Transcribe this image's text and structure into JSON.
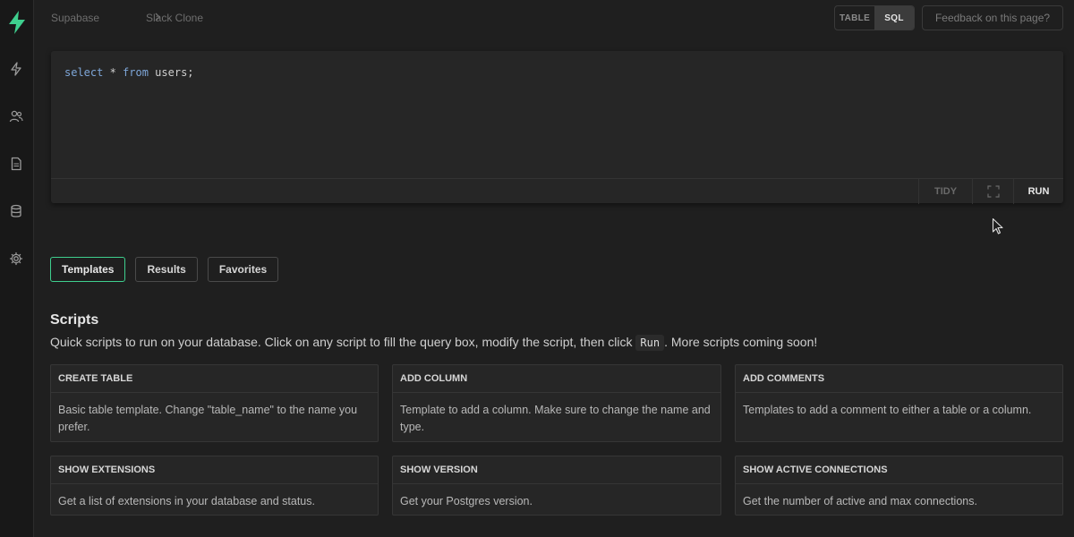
{
  "colors": {
    "accent": "#3ecf8e",
    "background": "#1f1f1f",
    "sidebar": "#181818",
    "keyword": "#7ea6d8"
  },
  "sidebar": {
    "logo": "supabase-bolt-logo",
    "items": [
      {
        "name": "lightning-icon"
      },
      {
        "name": "users-icon"
      },
      {
        "name": "document-icon"
      },
      {
        "name": "database-icon"
      },
      {
        "name": "gear-icon"
      }
    ]
  },
  "breadcrumb": {
    "root": "Supabase",
    "project": "Slack Clone"
  },
  "mode_toggle": {
    "table": "TABLE",
    "sql": "SQL",
    "active": "SQL"
  },
  "feedback": {
    "label": "Feedback on this page?"
  },
  "editor": {
    "code": {
      "kw1": "select",
      "star": " * ",
      "kw2": "from",
      "rest": " users;"
    },
    "tidy": "TIDY",
    "run": "RUN"
  },
  "tabs": [
    {
      "label": "Templates",
      "active": true
    },
    {
      "label": "Results"
    },
    {
      "label": "Favorites"
    }
  ],
  "scripts": {
    "title": "Scripts",
    "desc_before": "Quick scripts to run on your database. Click on any script to fill the query box, modify the script, then click ",
    "desc_kbd": "Run",
    "desc_after": ". More scripts coming soon!",
    "cards": [
      {
        "title": "CREATE TABLE",
        "body": "Basic table template. Change \"table_name\" to the name you prefer."
      },
      {
        "title": "ADD COLUMN",
        "body": "Template to add a column. Make sure to change the name and type."
      },
      {
        "title": "ADD COMMENTS",
        "body": "Templates to add a comment to either a table or a column."
      },
      {
        "title": "SHOW EXTENSIONS",
        "body": "Get a list of extensions in your database and status."
      },
      {
        "title": "SHOW VERSION",
        "body": "Get your Postgres version."
      },
      {
        "title": "SHOW ACTIVE CONNECTIONS",
        "body": "Get the number of active and max connections."
      }
    ]
  }
}
